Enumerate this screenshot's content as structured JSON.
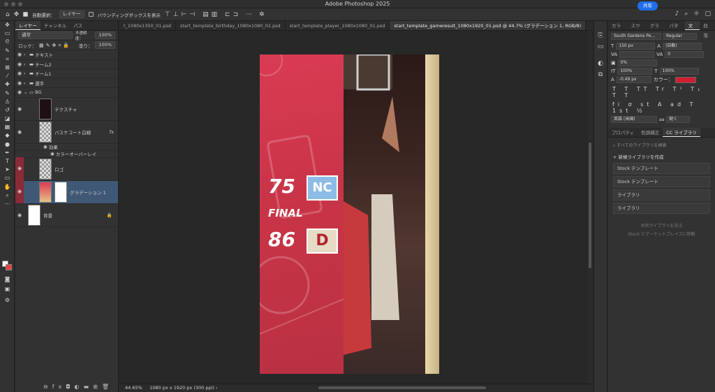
{
  "window": {
    "title": "Adobe Photoshop 2025"
  },
  "options_bar": {
    "auto_select_label": "自動選択：",
    "auto_select_target": "レイヤー",
    "bounding_box_label": "バウンディングボックスを表示",
    "share_label": "共有"
  },
  "layers_panel": {
    "tabs": [
      "レイヤー",
      "チャンネル",
      "パス"
    ],
    "blend_mode": "通常",
    "opacity_label": "不透明度：",
    "opacity_value": "100%",
    "lock_label": "ロック：",
    "fill_label": "塗り：",
    "fill_value": "100%",
    "layers": [
      {
        "name": "テキスト",
        "type": "group"
      },
      {
        "name": "チーム2",
        "type": "group"
      },
      {
        "name": "チーム1",
        "type": "group"
      },
      {
        "name": "選手",
        "type": "group"
      },
      {
        "name": "BG",
        "type": "group-open"
      },
      {
        "name": "テクスチャ",
        "type": "layer"
      },
      {
        "name": "バスケコート白線",
        "type": "layer",
        "fx": "fx"
      },
      {
        "name": "効果",
        "type": "effect"
      },
      {
        "name": "カラーオーバーレイ",
        "type": "effect"
      },
      {
        "name": "ロゴ",
        "type": "layer"
      },
      {
        "name": "グラデーション 1",
        "type": "layer",
        "selected": true
      },
      {
        "name": "背景",
        "type": "layer"
      }
    ]
  },
  "doc_tabs": [
    "t_1080x1350_01.psd",
    "start_template_birthday_1080x1080_02.psd",
    "start_template_player_1080x1080_01.psd",
    "start_template_gameresult_1080x1920_01.psd @ 44.7% (グラデーション 1, RGB/8)"
  ],
  "canvas": {
    "score_top": "75",
    "final_label": "FINAL",
    "score_bottom": "86",
    "logo_top": "NC",
    "logo_bottom": "D"
  },
  "status": {
    "zoom": "44.65%",
    "doc_info": "1080 px x 1920 px (300 ppi)"
  },
  "right_panel": {
    "tabs": [
      "カラー",
      "スウォ",
      "グラデ",
      "パター",
      "文字",
      "段落"
    ],
    "font_family": "South Gardens Pe...",
    "font_style": "Regular",
    "font_size": "150 px",
    "leading": "(自動)",
    "kerning": "",
    "tracking": "0",
    "vscale_pct": "0%",
    "vscale": "100%",
    "hscale": "100%",
    "baseline": "-0.49 px",
    "color_label": "カラー：",
    "color_value": "#d01f2e",
    "language": "英語 (米国)",
    "anti_alias": "鋭く",
    "lib_tabs": [
      "プロパティ",
      "色調補正",
      "CC ライブラリ"
    ],
    "search_placeholder": "すべてのライブラリを検索",
    "new_library": "新規ライブラリを作成",
    "libraries": [
      "Stock テンプレート",
      "Stock テンプレート",
      "ライブラリ",
      "ライブラリ"
    ],
    "shared_link": "共有ライブラリを見る",
    "market_link": "Stock とマーケットプレイスに移動"
  }
}
